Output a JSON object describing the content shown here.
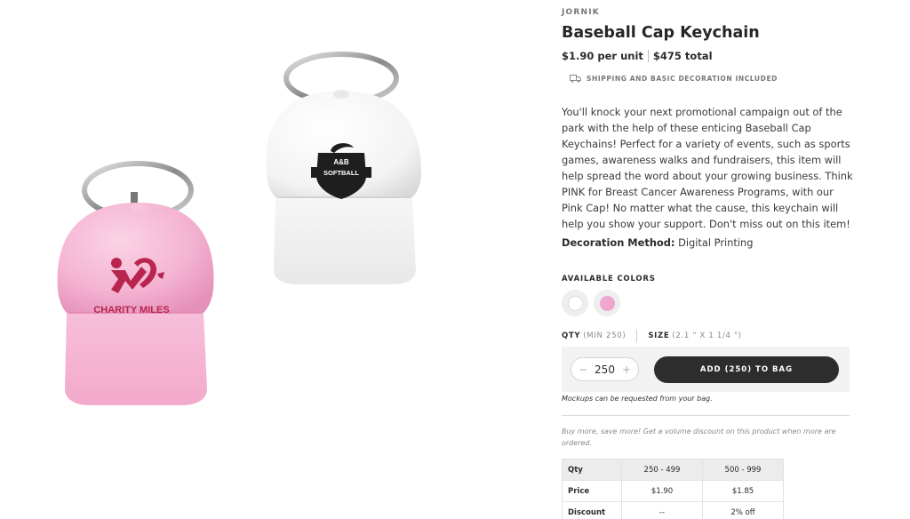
{
  "product": {
    "brand": "JORNIK",
    "title": "Baseball Cap Keychain",
    "unit_price": "$1.90 per unit",
    "total_price": "$475 total",
    "shipping_note": "SHIPPING AND BASIC DECORATION INCLUDED",
    "description": "You'll knock your next promotional campaign out of the park with the help of these enticing Baseball Cap Keychains! Perfect for a variety of events, such as sports games, awareness walks and fundraisers, this item will help spread the word about your growing business. Think PINK for Breast Cancer Awareness Programs, with our Pink Cap! No matter what the cause, this keychain will help you show your support. Don't miss out on this item!",
    "decoration_label": "Decoration Method:",
    "decoration_value": "Digital Printing"
  },
  "images": {
    "pink_cap_text": "CHARITY MILES",
    "white_cap_text_top": "A&B",
    "white_cap_text": "SOFTBALL"
  },
  "colors": {
    "label": "AVAILABLE COLORS",
    "options": [
      {
        "name": "white",
        "hex": "#ffffff"
      },
      {
        "name": "pink",
        "hex": "#f0a6cf"
      }
    ]
  },
  "order": {
    "qty_label": "QTY",
    "qty_min": "(MIN 250)",
    "size_label": "SIZE",
    "size_value": "(2.1 \" X 1 1/4 \")",
    "quantity": "250",
    "minus": "−",
    "plus": "+",
    "add_button": "ADD (250) TO BAG",
    "mockup_note": "Mockups can be requested from your bag.",
    "volume_note": "Buy more, save more! Get a volume discount on this product when more are ordered."
  },
  "price_table": {
    "rows": [
      [
        "Qty",
        "250 - 499",
        "500 - 999"
      ],
      [
        "Price",
        "$1.90",
        "$1.85"
      ],
      [
        "Discount",
        "--",
        "2% off"
      ]
    ]
  }
}
